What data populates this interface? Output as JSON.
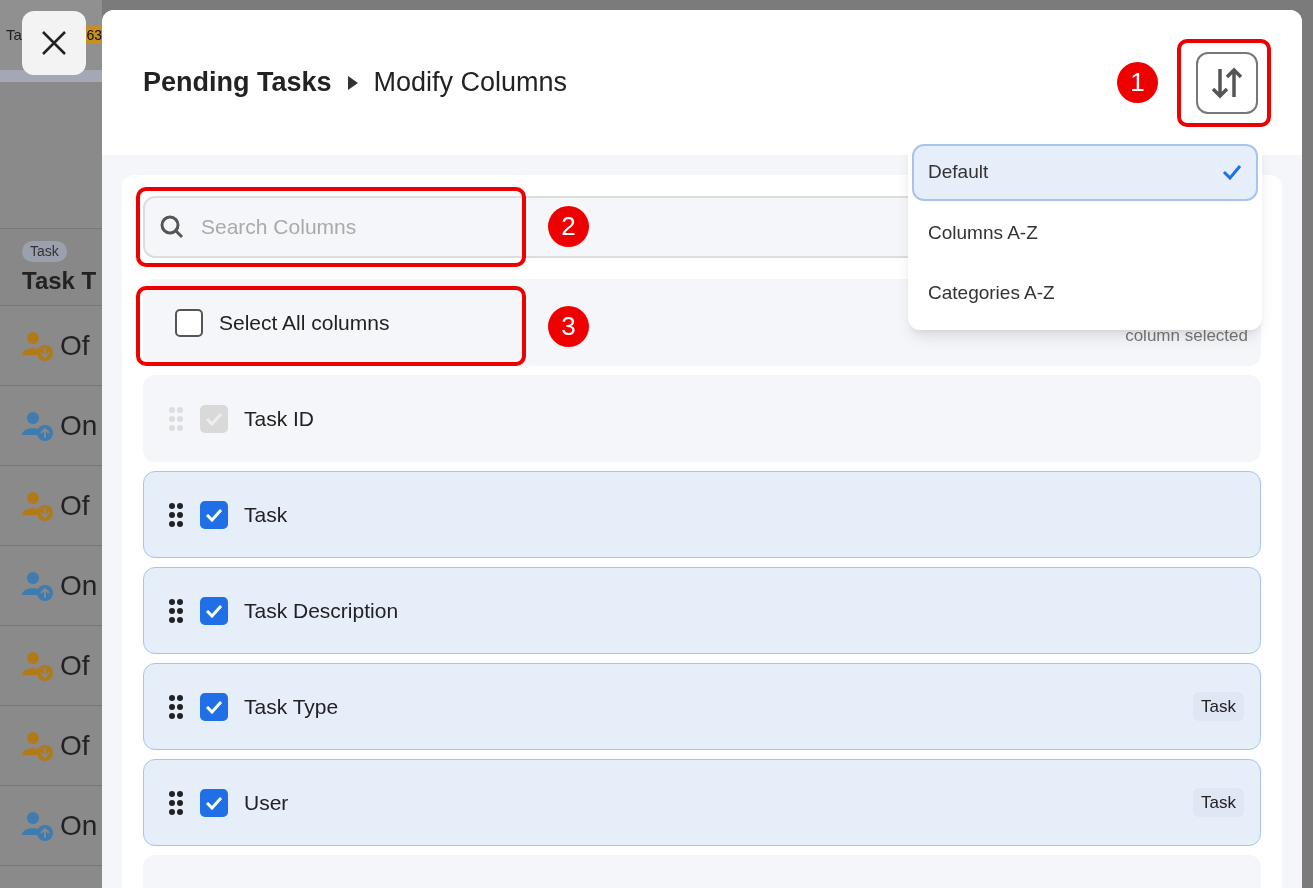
{
  "background_page": {
    "tab_text": "Ta",
    "count_badge": "63",
    "column_tag": "Task",
    "column_header": "Task T",
    "rows": [
      {
        "kind": "offline",
        "text": "Of"
      },
      {
        "kind": "online",
        "text": "On"
      },
      {
        "kind": "offline",
        "text": "Of"
      },
      {
        "kind": "online",
        "text": "On"
      },
      {
        "kind": "offline",
        "text": "Of"
      },
      {
        "kind": "offline",
        "text": "Of"
      },
      {
        "kind": "online",
        "text": "On"
      }
    ]
  },
  "modal": {
    "breadcrumb": [
      "Pending Tasks",
      "Modify Columns"
    ],
    "search": {
      "placeholder": "Search Columns"
    },
    "select_all": {
      "label": "Select All columns",
      "checked": false
    },
    "selection_note": "column selected",
    "columns": [
      {
        "label": "Task ID",
        "checked": true,
        "disabled": true
      },
      {
        "label": "Task",
        "checked": true,
        "disabled": false
      },
      {
        "label": "Task Description",
        "checked": true,
        "disabled": false
      },
      {
        "label": "Task Type",
        "checked": true,
        "disabled": false,
        "tag": "Task"
      },
      {
        "label": "User",
        "checked": true,
        "disabled": false,
        "tag": "Task"
      }
    ],
    "sort_menu": [
      {
        "label": "Default",
        "selected": true
      },
      {
        "label": "Columns A-Z",
        "selected": false
      },
      {
        "label": "Categories A-Z",
        "selected": false
      }
    ]
  },
  "annotations": [
    "1",
    "2",
    "3"
  ]
}
